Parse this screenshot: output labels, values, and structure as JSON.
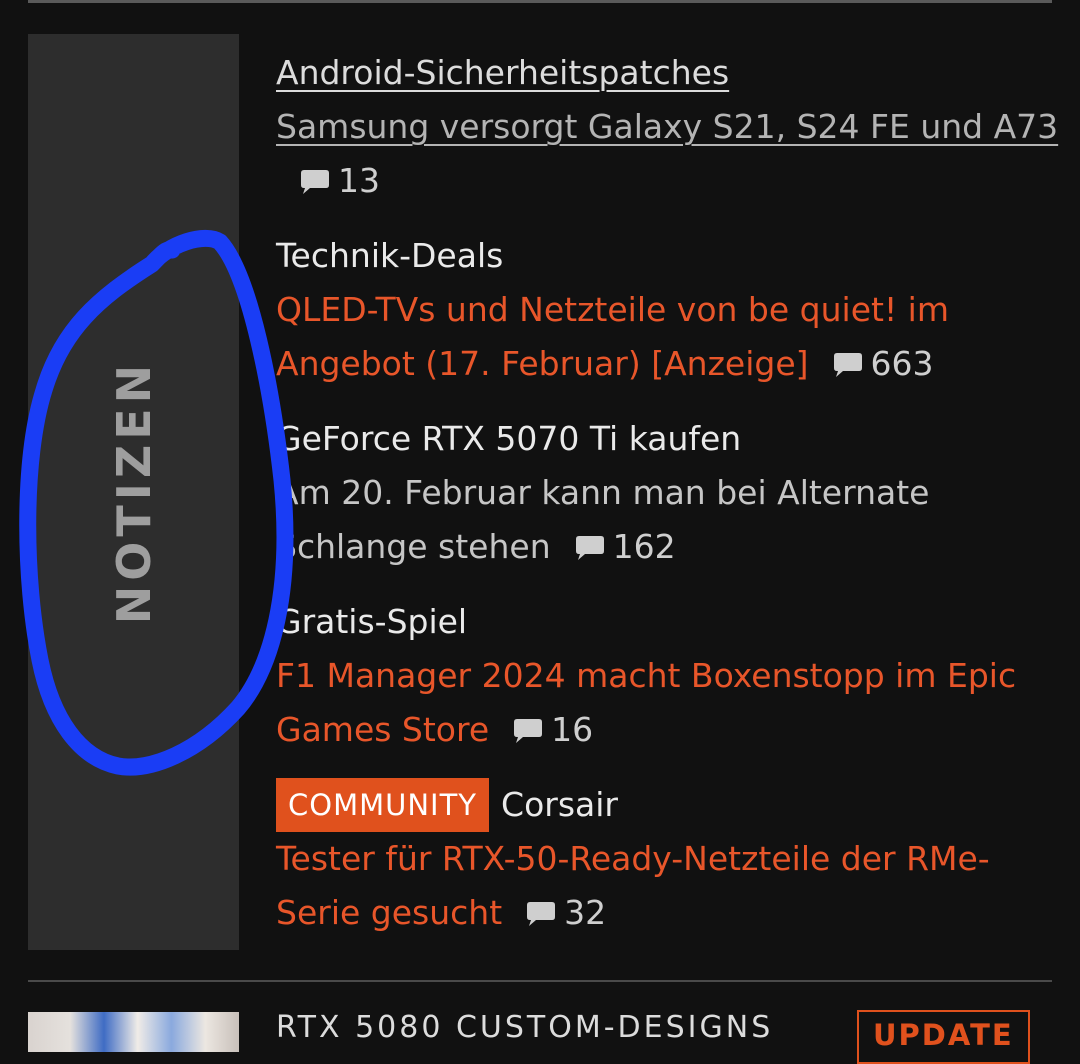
{
  "notes_panel": {
    "label": "NOTIZEN"
  },
  "colors": {
    "accent": "#e8562a",
    "annotation": "#1a3df5",
    "panel": "#2d2d2d",
    "background": "#111111"
  },
  "icons": {
    "comment": "speech-bubble-icon"
  },
  "news": [
    {
      "kicker": "Android-Sicherheitspatches",
      "headline": "Samsung versorgt Galaxy S21, S24 FE und A73",
      "comments": "13"
    },
    {
      "kicker": "Technik-Deals",
      "headline": "QLED-TVs und Netzteile von be quiet! im Angebot (17. Februar) [Anzeige]",
      "comments": "663"
    },
    {
      "kicker": "GeForce RTX 5070 Ti kaufen",
      "headline": "Am 20. Februar kann man bei Alternate Schlange stehen",
      "comments": "162"
    },
    {
      "kicker": "Gratis-Spiel",
      "headline": "F1 Manager 2024 macht Boxenstopp im Epic Games Store",
      "comments": "16"
    },
    {
      "badge": "COMMUNITY",
      "kicker": "Corsair",
      "headline": "Tester für RTX-50-Ready-Netzteile der RMe-Serie gesucht",
      "comments": "32"
    }
  ],
  "next_article": {
    "title": "RTX 5080 CUSTOM-DESIGNS",
    "badge": "UPDATE"
  }
}
